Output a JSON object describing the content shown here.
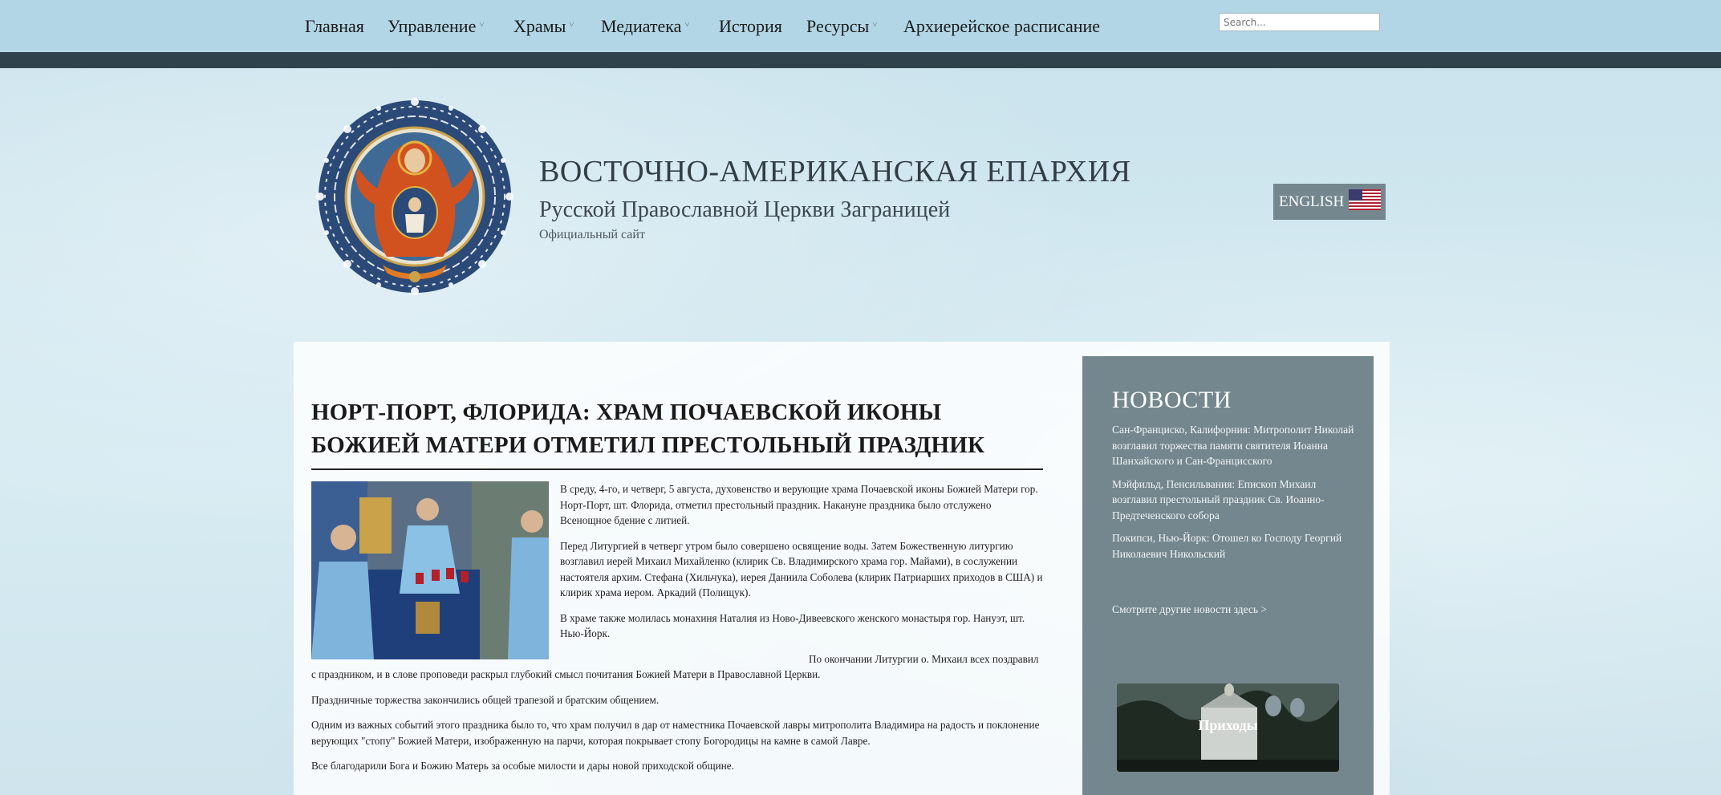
{
  "nav": {
    "items": [
      {
        "label": "Главная",
        "dropdown": false
      },
      {
        "label": "Управление",
        "dropdown": true
      },
      {
        "label": "Храмы",
        "dropdown": true
      },
      {
        "label": "Медиатека",
        "dropdown": true
      },
      {
        "label": "История",
        "dropdown": false
      },
      {
        "label": "Ресурсы",
        "dropdown": true
      },
      {
        "label": "Архиерейское расписание",
        "dropdown": false
      }
    ],
    "chevron": "˅",
    "search_placeholder": "Search..."
  },
  "header": {
    "title": "ВОСТОЧНО-АМЕРИКАНСКАЯ ЕПАРХИЯ",
    "subtitle": "Русской Православной Церкви Заграницей",
    "tagline": "Официальный сайт",
    "language_button": "ENGLISH",
    "logo_icon": "icon-of-theotokos-of-the-sign-logo",
    "flag_icon": "us-flag-icon"
  },
  "article": {
    "title": "НОРТ-ПОРТ, ФЛОРИДА: ХРАМ ПОЧАЕВСКОЙ ИКОНЫ БОЖИЕЙ МАТЕРИ ОТМЕТИЛ ПРЕСТОЛЬНЫЙ ПРАЗДНИК",
    "paragraphs": [
      "В среду, 4-го, и четверг, 5 августа, духовенство и верующие храма Почаевской иконы Божией Матери гор. Норт-Порт, шт. Флорида, отметил престольный праздник. Накануне праздника было отслужено Всенощное бдение с литией.",
      "Перед Литургией в четверг утром было совершено освящение воды. Затем Божественную литургию возглавил иерей Михаил Михайленко (клирик Св. Владимирского храма гор. Майами), в сослужении настоятеля архим. Стефана (Хильчука), иерея Даниила Соболева (клирик Патриарших приходов в США) и клирик храма иером. Аркадий (Полищук).",
      "В храме также молилась монахиня Наталия из Ново-Дивеевского женского монастыря гор. Нануэт, шт. Нью-Йорк.",
      "По окончании Литургии о. Михаил всех поздравил с праздником, и в слове проповеди раскрыл глубокий смысл почитания Божией Матери в Православной Церкви.",
      "Праздничные торжества закончились общей трапезой и братским общением.",
      "Одним из важных событий этого праздника было то, что храм получил в дар от наместника Почаевской лавры митрополита Владимира на радость и поклонение верующих \"стопу\" Божией Матери, изображенную на парчи, которая покрывает стопу Богородицы на камне в самой Лавре.",
      "Все благодарили Бога и Божию Матерь за особые милости и дары новой приходской общине."
    ]
  },
  "sidebar": {
    "news_heading": "НОВОСТИ",
    "news": [
      "Сан-Франциско, Калифорния: Митрополит Николай возглавил торжества памяти святителя Иоанна Шанхайского и Сан-Францисского",
      "Мэйфильд, Пенсильвания: Епископ Михаил возглавил престольный праздник Св. Иоанно-Предтеченского собора",
      "Покипси, Нью-Йорк: Отошел ко Господу Георгий Николаевич Никольский"
    ],
    "more_link": "Смотрите другие новости здесь >",
    "parish_label": "Приходы"
  }
}
